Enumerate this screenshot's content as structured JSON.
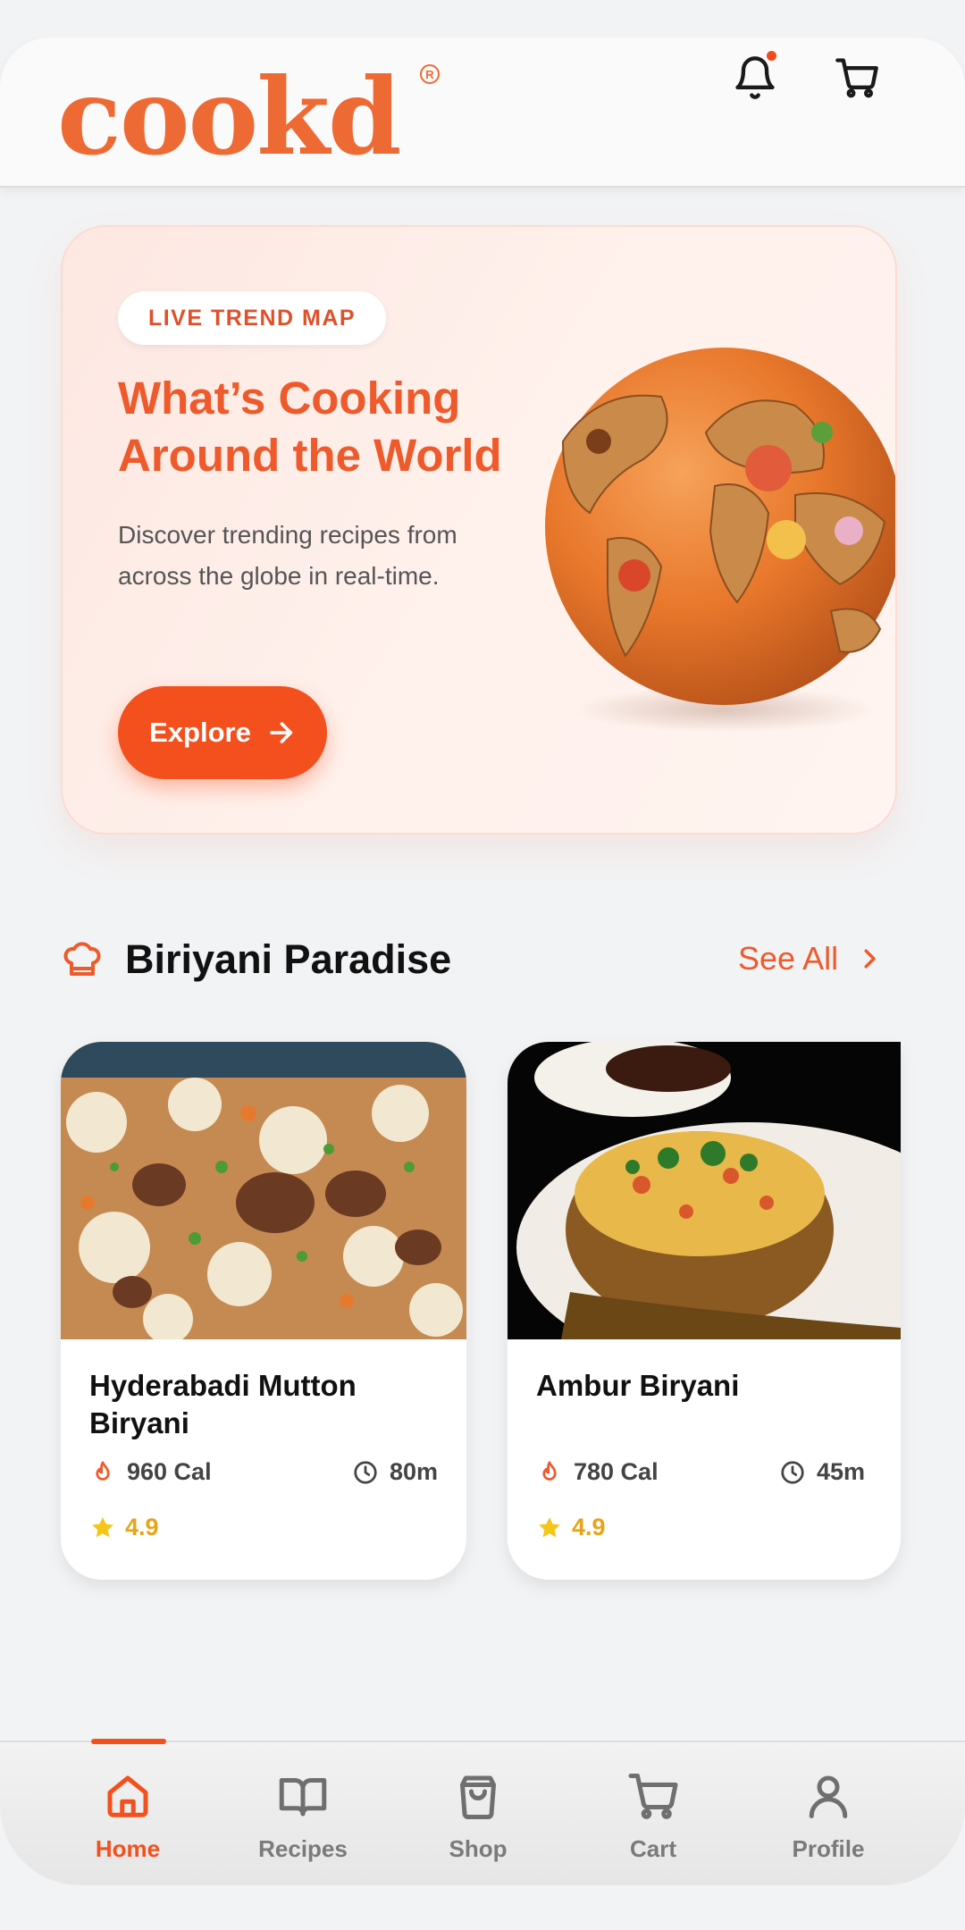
{
  "header": {
    "logo_text": "cookd",
    "logo_mark": "R",
    "icons": [
      "bell-icon",
      "cart-icon"
    ],
    "notification_dot_color": "#f04a1e"
  },
  "hero": {
    "badge": "LIVE TREND MAP",
    "title": "What’s Cooking Around the World",
    "description": "Discover trending recipes from across the globe in real-time.",
    "cta_label": "Explore"
  },
  "section": {
    "title": "Biriyani Paradise",
    "see_all": "See All"
  },
  "recipes": [
    {
      "name": "Hyderabadi Mutton Biryani",
      "calories": "960 Cal",
      "time": "80m",
      "rating": "4.9"
    },
    {
      "name": "Ambur Biryani",
      "calories": "780 Cal",
      "time": "45m",
      "rating": "4.9"
    }
  ],
  "nav": {
    "items": [
      {
        "label": "Home",
        "icon": "home-icon",
        "active": true
      },
      {
        "label": "Recipes",
        "icon": "book-icon",
        "active": false
      },
      {
        "label": "Shop",
        "icon": "shopping-bag-icon",
        "active": false
      },
      {
        "label": "Cart",
        "icon": "cart-icon",
        "active": false
      },
      {
        "label": "Profile",
        "icon": "user-icon",
        "active": false
      }
    ]
  },
  "colors": {
    "accent": "#f4501e",
    "brand": "#ee6a35",
    "rating": "#e8a417",
    "background": "#f2f3f5"
  }
}
